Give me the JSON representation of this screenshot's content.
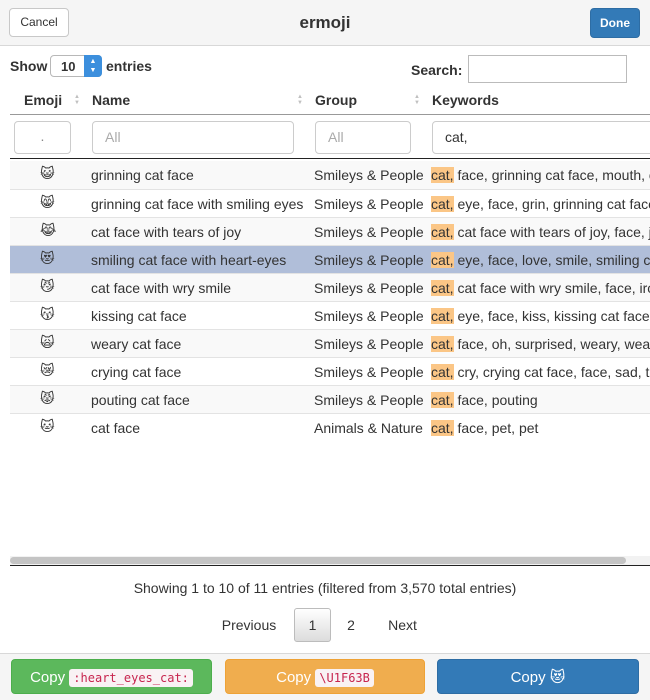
{
  "titlebar": {
    "cancel": "Cancel",
    "title": "ermoji",
    "done": "Done"
  },
  "controls": {
    "show": "Show",
    "length": "10",
    "entries": "entries",
    "search_label": "Search:",
    "search_value": ""
  },
  "columns": {
    "emoji": "Emoji",
    "name": "Name",
    "group": "Group",
    "keywords": "Keywords"
  },
  "filters": {
    "emoji": ".",
    "name_placeholder": "All",
    "group_placeholder": "All",
    "keywords_value": "cat,"
  },
  "rows": [
    {
      "emoji": "😺",
      "name": "grinning cat face",
      "group": "Smileys & People",
      "kw_hl": "cat,",
      "kw_rest": " face, grinning cat face, mouth, open, smile"
    },
    {
      "emoji": "😸",
      "name": "grinning cat face with smiling eyes",
      "group": "Smileys & People",
      "kw_hl": "cat,",
      "kw_rest": " eye, face, grin, grinning cat face with smiling eyes"
    },
    {
      "emoji": "😹",
      "name": "cat face with tears of joy",
      "group": "Smileys & People",
      "kw_hl": "cat,",
      "kw_rest": " cat face with tears of joy, face, joy, tear"
    },
    {
      "emoji": "😻",
      "name": "smiling cat face with heart-eyes",
      "group": "Smileys & People",
      "kw_hl": "cat,",
      "kw_rest": " eye, face, love, smile, smiling cat face"
    },
    {
      "emoji": "😼",
      "name": "cat face with wry smile",
      "group": "Smileys & People",
      "kw_hl": "cat,",
      "kw_rest": " cat face with wry smile, face, ironic, smile, wry"
    },
    {
      "emoji": "😽",
      "name": "kissing cat face",
      "group": "Smileys & People",
      "kw_hl": "cat,",
      "kw_rest": " eye, face, kiss, kissing cat face"
    },
    {
      "emoji": "🙀",
      "name": "weary cat face",
      "group": "Smileys & People",
      "kw_hl": "cat,",
      "kw_rest": " face, oh, surprised, weary, weary cat face"
    },
    {
      "emoji": "😿",
      "name": "crying cat face",
      "group": "Smileys & People",
      "kw_hl": "cat,",
      "kw_rest": " cry, crying cat face, face, sad, tear"
    },
    {
      "emoji": "😾",
      "name": "pouting cat face",
      "group": "Smileys & People",
      "kw_hl": "cat,",
      "kw_rest": " face, pouting"
    },
    {
      "emoji": "🐱",
      "name": "cat face",
      "group": "Animals & Nature",
      "kw_hl": "cat,",
      "kw_rest": " face, pet, pet"
    }
  ],
  "info": "Showing 1 to 10 of 11 entries (filtered from 3,570 total entries)",
  "pagination": {
    "previous": "Previous",
    "page1": "1",
    "page2": "2",
    "next": "Next"
  },
  "footer": {
    "copy_label": "Copy",
    "alias": ":heart_eyes_cat:",
    "unicode": "\\U1F63B",
    "emoji": "😻"
  },
  "colors": {
    "primary": "#337ab7",
    "success": "#5cb85c",
    "warning": "#f0ad4e",
    "highlight": "#fbc686",
    "selected_row": "#b0bed9"
  }
}
